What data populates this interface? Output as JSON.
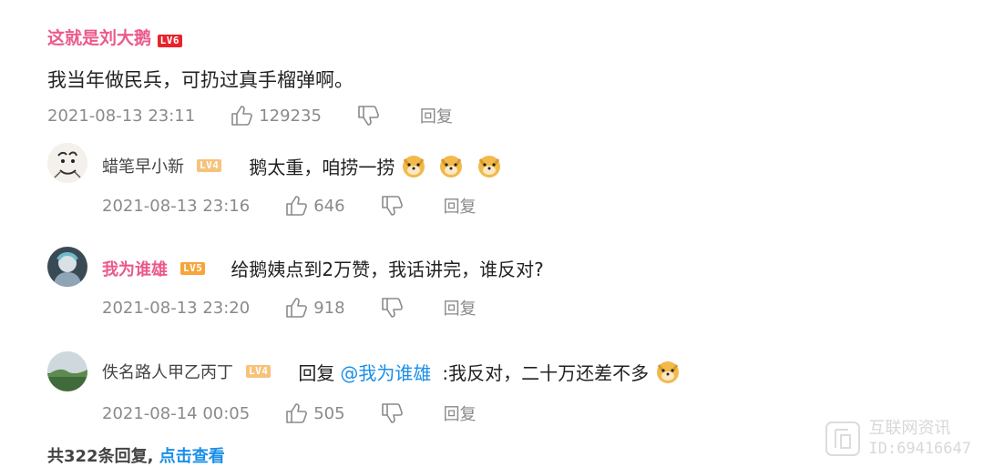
{
  "main_comment": {
    "username": "这就是刘大鹅",
    "level": "LV6",
    "text": "我当年做民兵，可扔过真手榴弹啊。",
    "time": "2021-08-13 23:11",
    "likes": "129235",
    "reply_label": "回复"
  },
  "replies": [
    {
      "username": "蜡笔早小新",
      "level": "LV4",
      "text": "鹅太重，咱捞一捞",
      "emoji_count": 3,
      "time": "2021-08-13 23:16",
      "likes": "646",
      "reply_label": "回复"
    },
    {
      "username": "我为谁雄",
      "level": "LV5",
      "text": "给鹅姨点到2万赞，我话讲完，谁反对?",
      "time": "2021-08-13 23:20",
      "likes": "918",
      "reply_label": "回复"
    },
    {
      "username": "佚名路人甲乙丙丁",
      "level": "LV4",
      "reply_prefix": "回复",
      "mention": "@我为谁雄",
      "text": ":我反对，二十万还差不多",
      "time": "2021-08-14 00:05",
      "likes": "505",
      "reply_label": "回复"
    }
  ],
  "footer": {
    "count_text": "共322条回复,",
    "view_link": "点击查看"
  },
  "watermark": {
    "line1": "互联网资讯",
    "line2": "ID:69416647"
  },
  "colors": {
    "pink_name": "#eb5a8c",
    "link_blue": "#1a8fe8",
    "meta_gray": "#8a8a8a"
  }
}
